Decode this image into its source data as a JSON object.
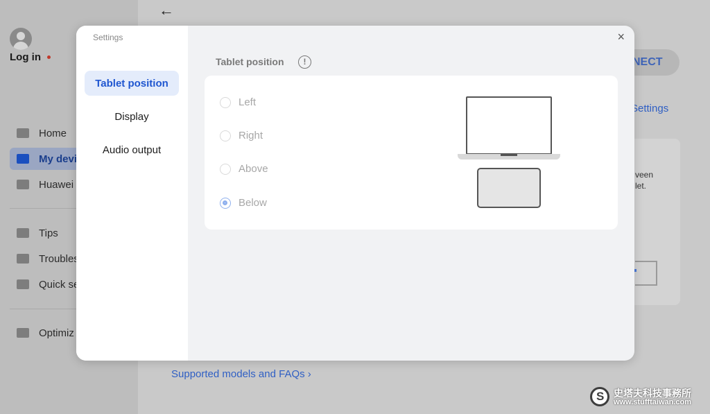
{
  "background": {
    "sidebar": {
      "login_label": "Log in",
      "nav": [
        {
          "label": "Home",
          "icon": "home-icon"
        },
        {
          "label": "My devi",
          "icon": "my-devices-icon",
          "active": true
        },
        {
          "label": "Huawei",
          "icon": "wireless-icon"
        },
        {
          "label": "Tips",
          "icon": "tips-icon"
        },
        {
          "label": "Troubles",
          "icon": "wrench-icon"
        },
        {
          "label": "Quick se",
          "icon": "shield-icon"
        },
        {
          "label": "Optimiz",
          "icon": "optimize-icon"
        }
      ]
    },
    "main": {
      "connect_label": "NECT",
      "settings_link": "Settings",
      "card_text_1": "veen",
      "card_text_2": "let.",
      "faq_link": "Supported models and FAQs ›"
    },
    "watermark": {
      "line1": "史塔夫科技事務所",
      "line2": "www.stufftaiwan.com"
    }
  },
  "modal": {
    "title": "Settings",
    "close_glyph": "×",
    "sidebar_items": [
      {
        "label": "Tablet position",
        "active": true
      },
      {
        "label": "Display",
        "active": false
      },
      {
        "label": "Audio output",
        "active": false
      }
    ],
    "section_label": "Tablet position",
    "info_glyph": "!",
    "options": [
      {
        "label": "Left",
        "checked": false
      },
      {
        "label": "Right",
        "checked": false
      },
      {
        "label": "Above",
        "checked": false
      },
      {
        "label": "Below",
        "checked": true
      }
    ],
    "accent_color": "#1f56d0"
  }
}
